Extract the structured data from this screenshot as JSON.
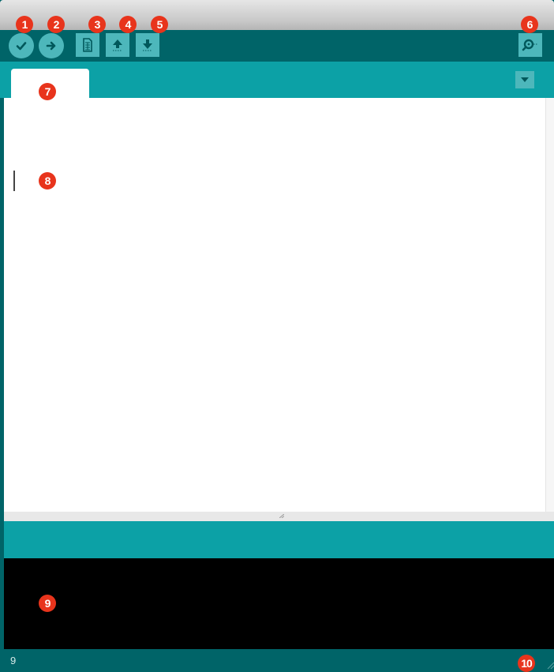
{
  "toolbar": {
    "buttons": [
      {
        "name": "verify-button",
        "icon": "checkmark-icon",
        "shape": "round"
      },
      {
        "name": "upload-button",
        "icon": "right-arrow-icon",
        "shape": "round"
      },
      {
        "name": "new-button",
        "icon": "document-icon",
        "shape": "square"
      },
      {
        "name": "open-button",
        "icon": "up-arrow-icon",
        "shape": "square"
      },
      {
        "name": "save-button",
        "icon": "down-arrow-icon",
        "shape": "square"
      }
    ],
    "serial_monitor": {
      "icon": "magnifier-icon"
    }
  },
  "tabs": [
    {
      "label": ""
    }
  ],
  "tab_menu": {
    "icon": "chevron-down-icon"
  },
  "editor": {
    "text": ""
  },
  "message_area": {
    "text": ""
  },
  "console": {
    "text": ""
  },
  "status_bar": {
    "line_number": "9",
    "board_info": ""
  },
  "markers": [
    "1",
    "2",
    "3",
    "4",
    "5",
    "6",
    "7",
    "8",
    "9",
    "10"
  ],
  "colors": {
    "toolbar": "#006468",
    "tabbar": "#0ca1a6",
    "button": "#4db7bb",
    "console": "#000000",
    "marker": "#e8341c"
  }
}
